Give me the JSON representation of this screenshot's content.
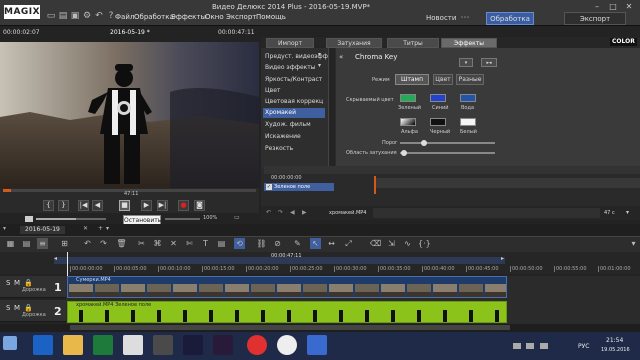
{
  "app": {
    "logo": "MAGIX",
    "title": "Видео Делюкс 2014 Plus - 2016-05-19.MVP*"
  },
  "menu": [
    "Файл",
    "Обработка",
    "Эффекты",
    "Окно",
    "Экспорт",
    "Помощь"
  ],
  "modes": {
    "news": "Новости",
    "edit": "Обработка",
    "export": "Экспорт"
  },
  "preview": {
    "time_left": "00:00:02:07",
    "title": "2016-05-19 *",
    "time_right": "00:00:47:11",
    "position": "47:11",
    "zoom": "100%"
  },
  "transport": {
    "buttons": [
      "{",
      "}",
      "|◀",
      "◀",
      "■",
      "▶",
      "▶|",
      "●",
      "◙"
    ],
    "tooltip": "Остановить"
  },
  "effects_tabs": [
    {
      "label": "Импорт",
      "active": false
    },
    {
      "label": "Затухания",
      "active": false
    },
    {
      "label": "Титры",
      "active": false
    },
    {
      "label": "Эффекты",
      "active": true
    }
  ],
  "effects_brand": "COLOR",
  "effects_list": {
    "header1": "Предуст. видеоэфф",
    "header2": "Видео эффекты",
    "items": [
      {
        "label": "Яркость/Контраст",
        "selected": false
      },
      {
        "label": "Цвет",
        "selected": false
      },
      {
        "label": "Цветовая коррекц",
        "selected": false
      },
      {
        "label": "Хромакей",
        "selected": true
      },
      {
        "label": "Худож. фильм",
        "selected": false
      },
      {
        "label": "Искажение",
        "selected": false
      },
      {
        "label": "Резкость",
        "selected": false
      }
    ]
  },
  "chroma": {
    "title": "Chroma Key",
    "mode_label": "Режим",
    "mode_buttons": [
      "Штамп",
      "Цвет",
      "Разные"
    ],
    "hidden_color_label": "Скрываемый цвет",
    "colors": [
      {
        "label": "Зеленый",
        "hex": "#22aa55"
      },
      {
        "label": "Синий",
        "hex": "#2244cc"
      },
      {
        "label": "Вода",
        "hex": "#2255aa"
      }
    ],
    "alpha": [
      {
        "label": "Альфа"
      },
      {
        "label": "Черный",
        "hex": "#111111"
      },
      {
        "label": "Белый",
        "hex": "#f4f4f4"
      }
    ],
    "threshold_label": "Порог",
    "fade_label": "Область затухания"
  },
  "mini_timeline": {
    "tc": "00:00:00:00",
    "track_label": "Зеленое поле",
    "file": "хромакей.MP4",
    "duration": "47 с"
  },
  "timeline": {
    "project": "2016-05-19",
    "marker": "00:00:47:11",
    "ticks": [
      "00:00:00:00",
      "00:00:05:00",
      "00:00:10:00",
      "00:00:15:00",
      "00:00:20:00",
      "00:00:25:00",
      "00:00:30:00",
      "00:00:35:00",
      "00:00:40:00",
      "00:00:45:00",
      "00:00:50:00",
      "00:00:55:00",
      "00:01:00:00"
    ],
    "tracks": [
      {
        "num": "1",
        "label": "Дорожка",
        "clip": "Сумерки.MP4"
      },
      {
        "num": "2",
        "label": "Дорожка",
        "clip": "хромакей.MP4 Зеленое поле"
      }
    ]
  },
  "taskbar": {
    "lang": "РУС",
    "time": "21:54",
    "date": "19.05.2016"
  }
}
